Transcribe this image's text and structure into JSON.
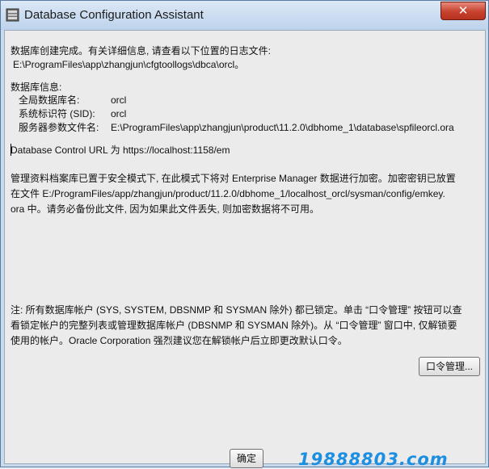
{
  "window": {
    "title": "Database Configuration Assistant",
    "close_glyph": "✕"
  },
  "creation": {
    "line1": "数据库创建完成。有关详细信息, 请查看以下位置的日志文件:",
    "log_path": "E:\\ProgramFiles\\app\\zhangjun\\cfgtoollogs\\dbca\\orcl。"
  },
  "db_info": {
    "heading": "数据库信息:",
    "rows": [
      {
        "label": "全局数据库名:",
        "value": "orcl"
      },
      {
        "label": "系统标识符 (SID):",
        "value": "orcl"
      },
      {
        "label": "服务器参数文件名:",
        "value": "E:\\ProgramFiles\\app\\zhangjun\\product\\11.2.0\\dbhome_1\\database\\spfileorcl.ora"
      }
    ]
  },
  "control_url": "Database Control URL 为 https://localhost:1158/em",
  "repository": {
    "lines": [
      "管理资料档案库已置于安全模式下, 在此模式下将对 Enterprise Manager 数据进行加密。加密密钥已放置",
      "在文件 E:/ProgramFiles/app/zhangjun/product/11.2.0/dbhome_1/localhost_orcl/sysman/config/emkey.",
      "ora 中。请务必备份此文件, 因为如果此文件丢失, 则加密数据将不可用。"
    ]
  },
  "note": {
    "lines": [
      "注: 所有数据库帐户 (SYS, SYSTEM, DBSNMP 和 SYSMAN 除外) 都已锁定。单击 “口令管理” 按钮可以查",
      "看锁定帐户的完整列表或管理数据库帐户 (DBSNMP 和 SYSMAN 除外)。从 “口令管理” 窗口中, 仅解锁要",
      "使用的帐户。Oracle Corporation 强烈建议您在解锁帐户后立即更改默认口令。"
    ]
  },
  "buttons": {
    "password_mgmt": "口令管理...",
    "ok": "确定"
  },
  "watermark": "19888803.com",
  "colors": {
    "client_bg": "#ebebeb",
    "frame": "#c9daed",
    "close": "#c7412d",
    "watermark": "#1d8fe0"
  }
}
